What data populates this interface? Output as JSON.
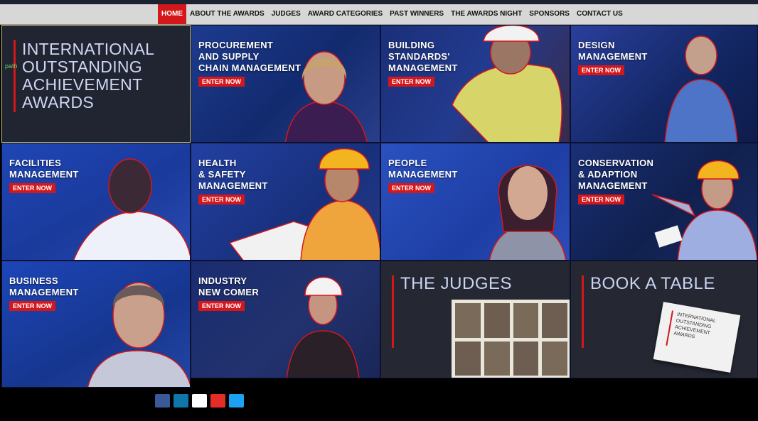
{
  "nav": {
    "items": [
      {
        "label": "HOME",
        "active": true
      },
      {
        "label": "ABOUT THE AWARDS"
      },
      {
        "label": "JUDGES"
      },
      {
        "label": "AWARD CATEGORIES"
      },
      {
        "label": "PAST WINNERS"
      },
      {
        "label": "THE AWARDS NIGHT"
      },
      {
        "label": "SPONSORS"
      },
      {
        "label": "CONTACT US"
      }
    ]
  },
  "hero": {
    "title_lines": [
      "INTERNATIONAL",
      "OUTSTANDING",
      "ACHIEVEMENT",
      "AWARDS"
    ],
    "path_marker": "path"
  },
  "categories": [
    {
      "lines": [
        "PROCUREMENT",
        "AND SUPPLY",
        "CHAIN MANAGEMENT"
      ],
      "cta": "ENTER NOW"
    },
    {
      "lines": [
        "BUILDING",
        "STANDARDS'",
        "MANAGEMENT"
      ],
      "cta": "ENTER NOW"
    },
    {
      "lines": [
        "DESIGN",
        "MANAGEMENT"
      ],
      "cta": "ENTER NOW"
    },
    {
      "lines": [
        "FACILITIES",
        "MANAGEMENT"
      ],
      "cta": "ENTER NOW"
    },
    {
      "lines": [
        "HEALTH",
        "& SAFETY",
        "MANAGEMENT"
      ],
      "cta": "ENTER NOW"
    },
    {
      "lines": [
        "PEOPLE",
        "MANAGEMENT"
      ],
      "cta": "ENTER NOW"
    },
    {
      "lines": [
        "CONSERVATION",
        "& ADAPTION",
        "MANAGEMENT"
      ],
      "cta": "ENTER NOW"
    },
    {
      "lines": [
        "BUSINESS",
        "MANAGEMENT"
      ],
      "cta": "ENTER NOW"
    },
    {
      "lines": [
        "INDUSTRY",
        "NEW COMER"
      ],
      "cta": "ENTER NOW"
    }
  ],
  "judges": {
    "title": "THE JUDGES"
  },
  "book": {
    "title": "BOOK A TABLE",
    "card_lines": [
      "INTERNATIONAL",
      "OUTSTANDING",
      "ACHIEVEMENT",
      "AWARDS"
    ]
  },
  "social": [
    {
      "icon": "facebook-icon",
      "color": "#3b5998"
    },
    {
      "icon": "linkedin-icon",
      "color": "#0e76a8"
    },
    {
      "icon": "flickr-icon",
      "color": "#ffffff"
    },
    {
      "icon": "youtube-icon",
      "color": "#e52d27"
    },
    {
      "icon": "twitter-icon",
      "color": "#1da1f2"
    }
  ],
  "colors": {
    "accent": "#d4171b",
    "tile_blue": "#1a3fa8",
    "dark_tile": "#252832"
  }
}
